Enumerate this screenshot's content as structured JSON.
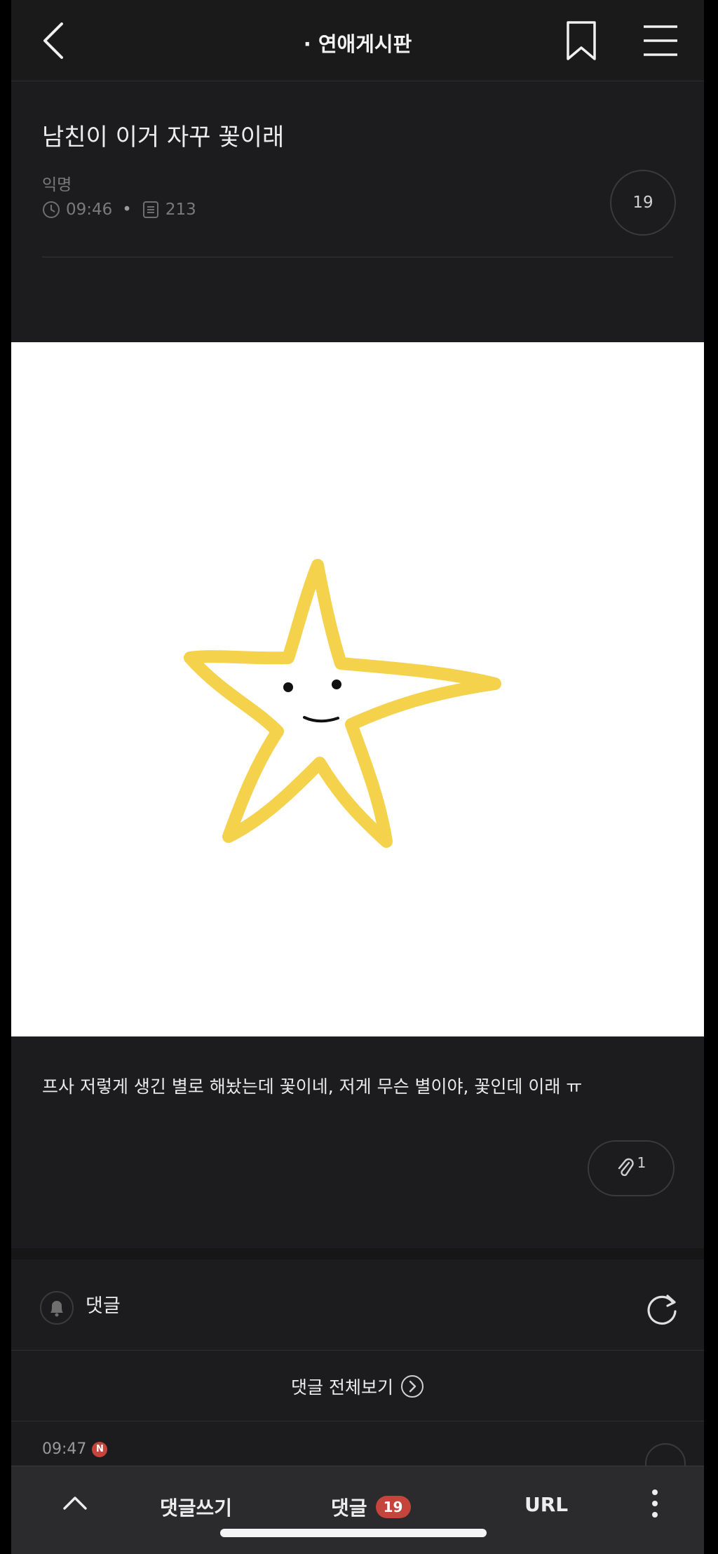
{
  "nav": {
    "board_title": "· 연애게시판"
  },
  "post": {
    "title": "남친이 이거 자꾸 꽃이래",
    "author": "익명",
    "time": "09:46",
    "views": "213",
    "comment_count": "19",
    "body": "프사 저렇게 생긴 별로 해놨는데 꽃이네, 저게 무슨 별이야, 꽃인데 이래 ㅠ",
    "attachment_count": "1",
    "image": {
      "star_color": "#f4d24c",
      "background": "#ffffff"
    }
  },
  "comments": {
    "label": "댓글",
    "view_all": "댓글 전체보기",
    "first_comment_time": "09:47",
    "new_badge": "N"
  },
  "bottom_bar": {
    "write_label": "댓글쓰기",
    "comments_label": "댓글",
    "comments_count": "19",
    "url_label": "URL"
  },
  "colors": {
    "background": "#1c1c1e",
    "accent_red": "#c5443c"
  }
}
